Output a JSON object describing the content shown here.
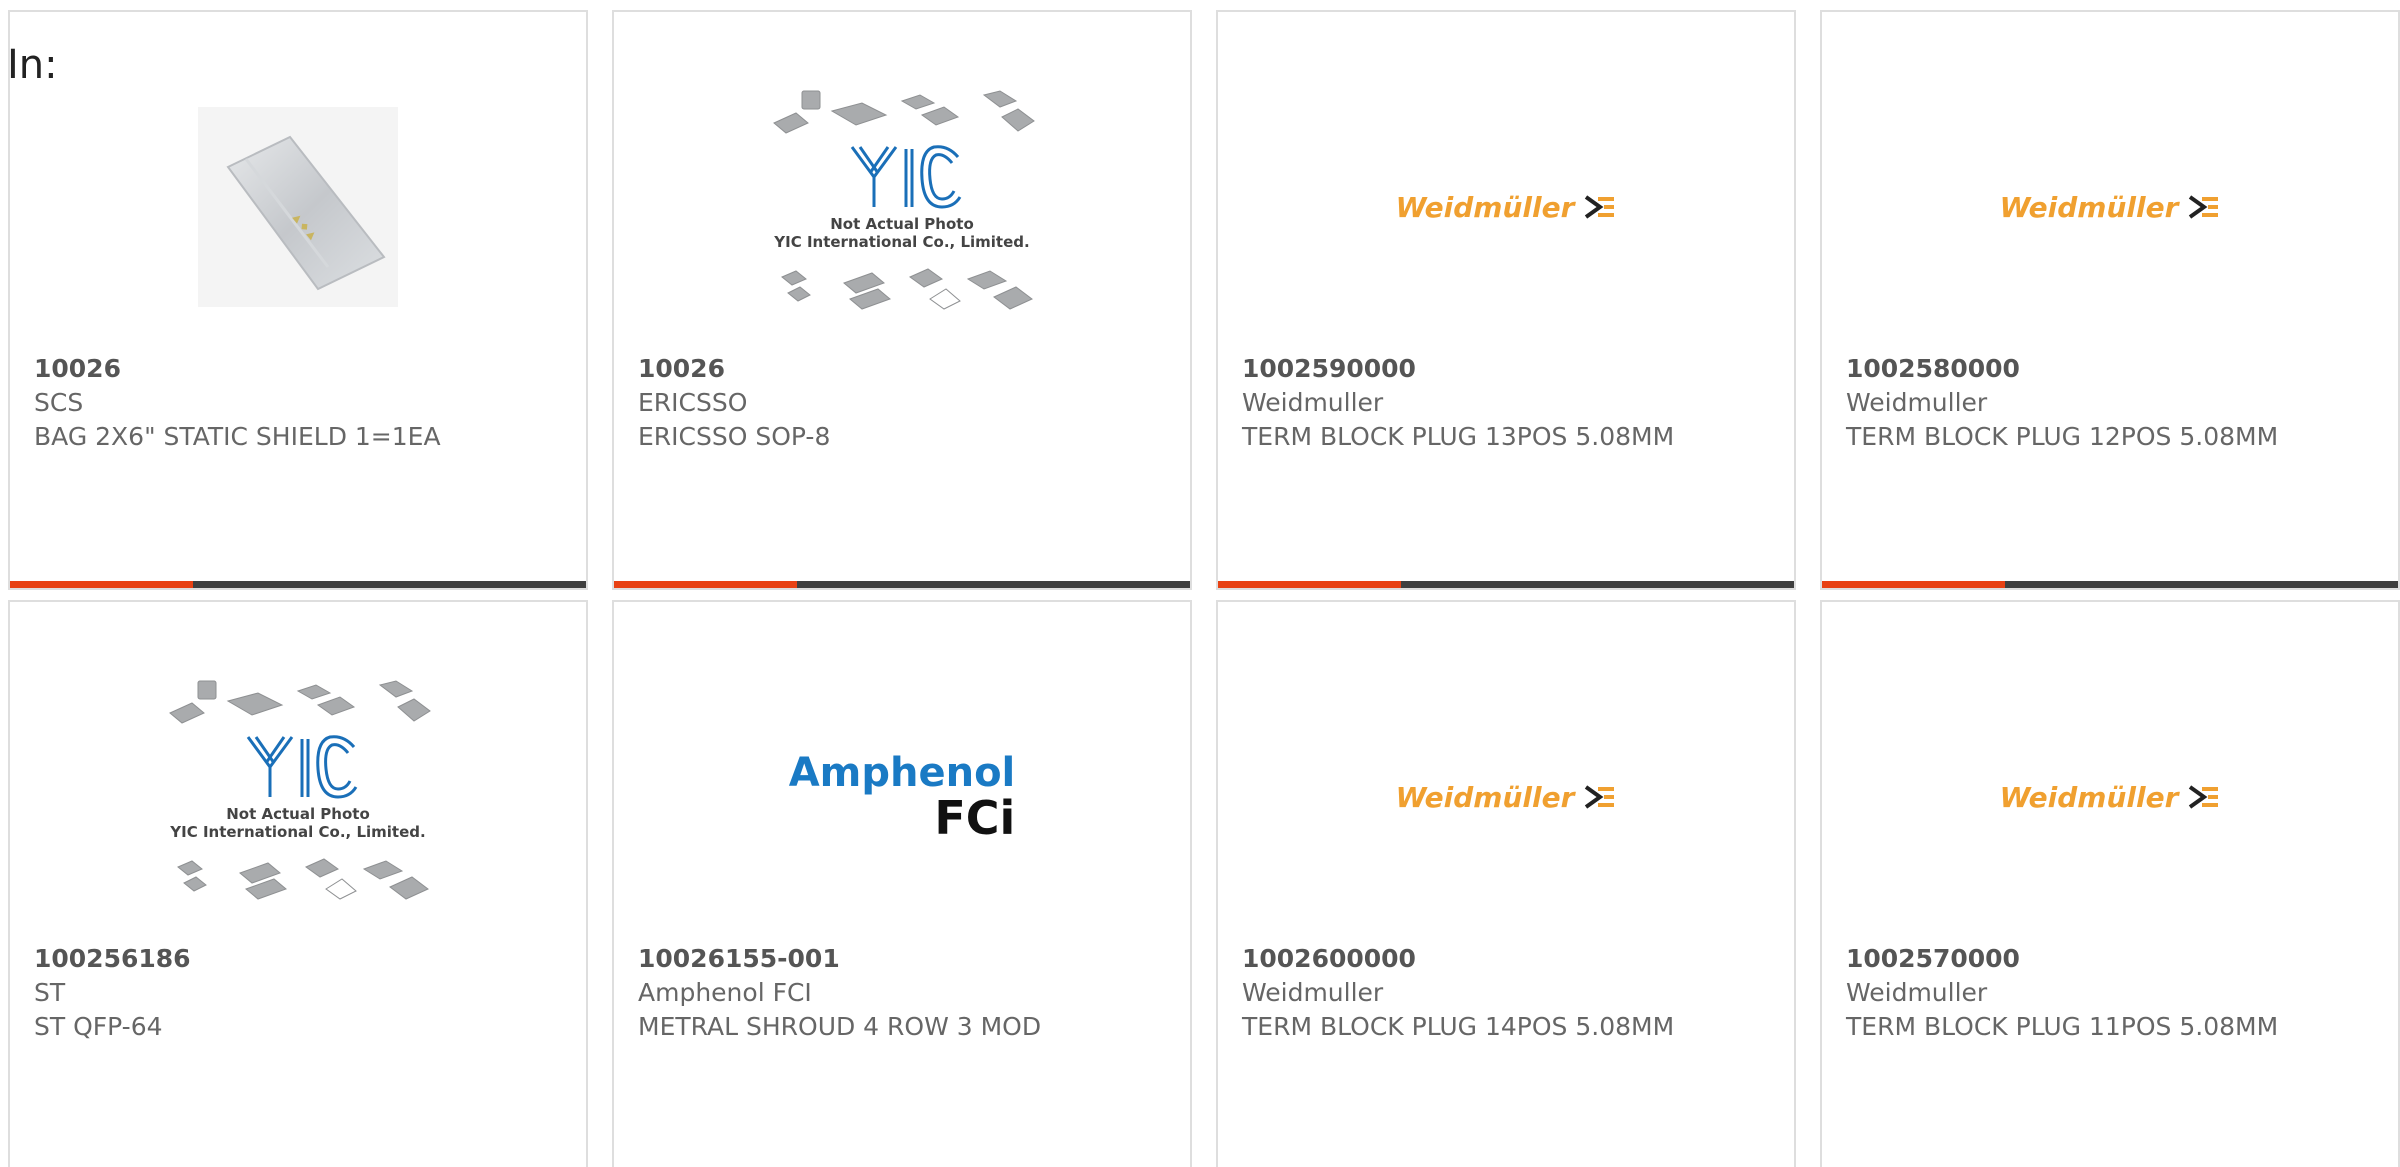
{
  "filter_label": "In:",
  "colors": {
    "accent": "#e84113",
    "bar": "#3f3f3f",
    "border": "#dedede",
    "weidmuller_orange": "#f0a030",
    "amphenol_blue": "#1a7ac4"
  },
  "products": [
    {
      "part_number": "10026",
      "manufacturer": "SCS",
      "description": "BAG 2X6\" STATIC SHIELD 1=1EA",
      "image": "static-shield-bag-photo"
    },
    {
      "part_number": "10026",
      "manufacturer": "ERICSSO",
      "description": "ERICSSO SOP-8",
      "image": "yic-placeholder",
      "image_text": {
        "logo": "YIC",
        "line1": "Not Actual Photo",
        "line2": "YIC International Co., Limited."
      }
    },
    {
      "part_number": "1002590000",
      "manufacturer": "Weidmuller",
      "description": "TERM BLOCK PLUG 13POS 5.08MM",
      "image": "weidmuller-logo",
      "image_text": {
        "logo": "Weidmüller"
      }
    },
    {
      "part_number": "1002580000",
      "manufacturer": "Weidmuller",
      "description": "TERM BLOCK PLUG 12POS 5.08MM",
      "image": "weidmuller-logo",
      "image_text": {
        "logo": "Weidmüller"
      }
    },
    {
      "part_number": "100256186",
      "manufacturer": "ST",
      "description": "ST QFP-64",
      "image": "yic-placeholder",
      "image_text": {
        "logo": "YIC",
        "line1": "Not Actual Photo",
        "line2": "YIC International Co., Limited."
      }
    },
    {
      "part_number": "10026155-001",
      "manufacturer": "Amphenol FCI",
      "description": "METRAL SHROUD 4 ROW 3 MOD",
      "image": "amphenol-fci-logo",
      "image_text": {
        "line1": "Amphenol",
        "line2": "FCi"
      }
    },
    {
      "part_number": "1002600000",
      "manufacturer": "Weidmuller",
      "description": "TERM BLOCK PLUG 14POS 5.08MM",
      "image": "weidmuller-logo",
      "image_text": {
        "logo": "Weidmüller"
      }
    },
    {
      "part_number": "1002570000",
      "manufacturer": "Weidmuller",
      "description": "TERM BLOCK PLUG 11POS 5.08MM",
      "image": "weidmuller-logo",
      "image_text": {
        "logo": "Weidmüller"
      }
    }
  ]
}
